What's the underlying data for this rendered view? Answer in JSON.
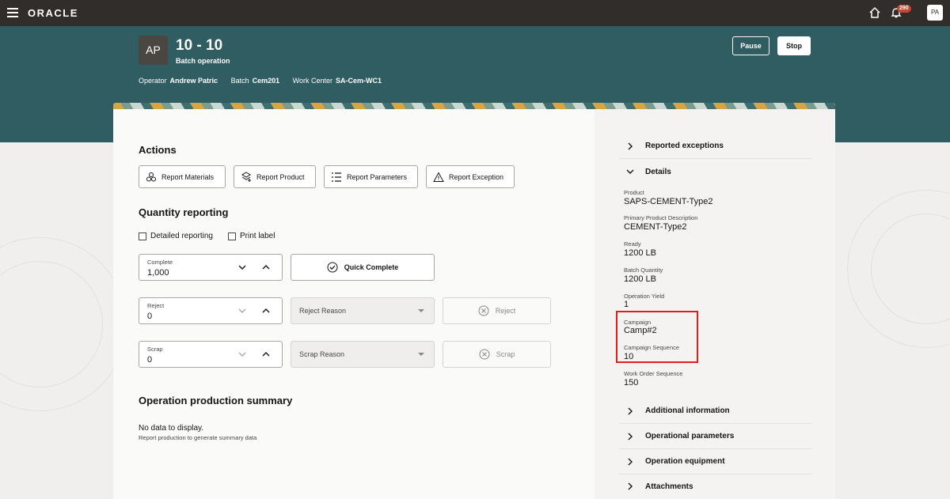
{
  "topbar": {
    "logo": "ORACLE",
    "badge": "290",
    "avatar": "PA"
  },
  "header": {
    "avatar": "AP",
    "title": "10 - 10",
    "subtitle": "Batch operation",
    "operator_label": "Operator",
    "operator": "Andrew Patric",
    "batch_label": "Batch",
    "batch": "Cem201",
    "wc_label": "Work Center",
    "wc": "SA-Cem-WC1",
    "pause": "Pause",
    "stop": "Stop"
  },
  "actions": {
    "heading": "Actions",
    "buttons": [
      "Report Materials",
      "Report Product",
      "Report Parameters",
      "Report Exception"
    ]
  },
  "quantity": {
    "heading": "Quantity reporting",
    "detailed": "Detailed reporting",
    "print": "Print label",
    "complete_label": "Complete",
    "complete_value": "1,000",
    "quick_complete": "Quick Complete",
    "reject_label": "Reject",
    "reject_value": "0",
    "reject_reason": "Reject Reason",
    "reject_btn": "Reject",
    "scrap_label": "Scrap",
    "scrap_value": "0",
    "scrap_reason": "Scrap Reason",
    "scrap_btn": "Scrap"
  },
  "summary": {
    "heading": "Operation production summary",
    "nodata": "No data to display.",
    "hint": "Report production to generate summary data"
  },
  "side": {
    "reported": "Reported exceptions",
    "details": "Details",
    "fields": [
      {
        "label": "Product",
        "value": "SAPS-CEMENT-Type2"
      },
      {
        "label": "Primary Product Description",
        "value": "CEMENT-Type2"
      },
      {
        "label": "Ready",
        "value": "1200 LB"
      },
      {
        "label": "Batch Quantity",
        "value": "1200 LB"
      },
      {
        "label": "Operation Yield",
        "value": "1"
      },
      {
        "label": "Campaign",
        "value": "Camp#2"
      },
      {
        "label": "Campaign Sequence",
        "value": "10"
      },
      {
        "label": "Work Order Sequence",
        "value": "150"
      }
    ],
    "additional": "Additional information",
    "opparams": "Operational parameters",
    "opequip": "Operation equipment",
    "attachments": "Attachments"
  }
}
